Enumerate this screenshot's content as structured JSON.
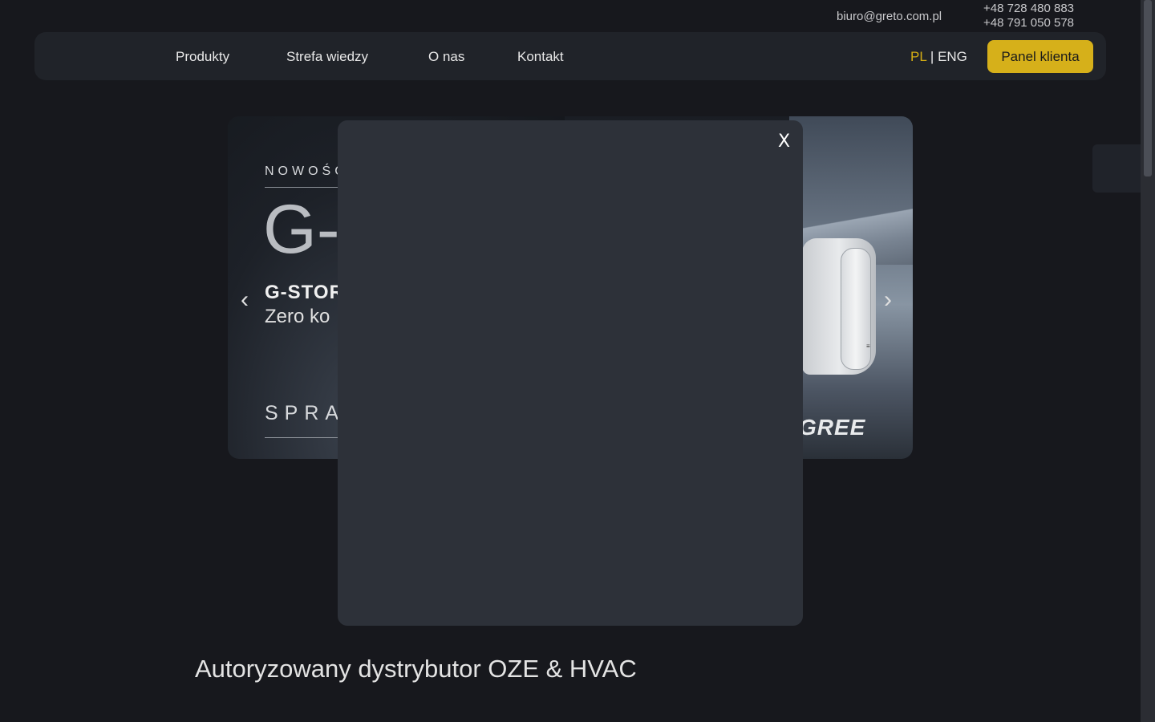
{
  "contact": {
    "email": "biuro@greto.com.pl",
    "phone1": "+48 728 480 883",
    "phone2": "+48 791 050 578"
  },
  "nav": {
    "items": [
      "Produkty",
      "Strefa wiedzy",
      "O nas",
      "Kontakt"
    ],
    "lang_pl": "PL",
    "lang_sep": "|",
    "lang_eng": "ENG",
    "panel_button": "Panel klienta"
  },
  "slide": {
    "kicker": "NOWOŚĆ",
    "big_text": "G-",
    "product": "G-STOR",
    "tagline": "Zero ko",
    "cta": "SPRAW",
    "brand": "GREE",
    "prev_arrow": "‹",
    "next_arrow": "›"
  },
  "modal": {
    "close_label": "X"
  },
  "main": {
    "heading": "Autoryzowany dystrybutor OZE & HVAC"
  },
  "colors": {
    "accent": "#d6b01a",
    "background": "#17181d",
    "modal": "#2d3139"
  }
}
